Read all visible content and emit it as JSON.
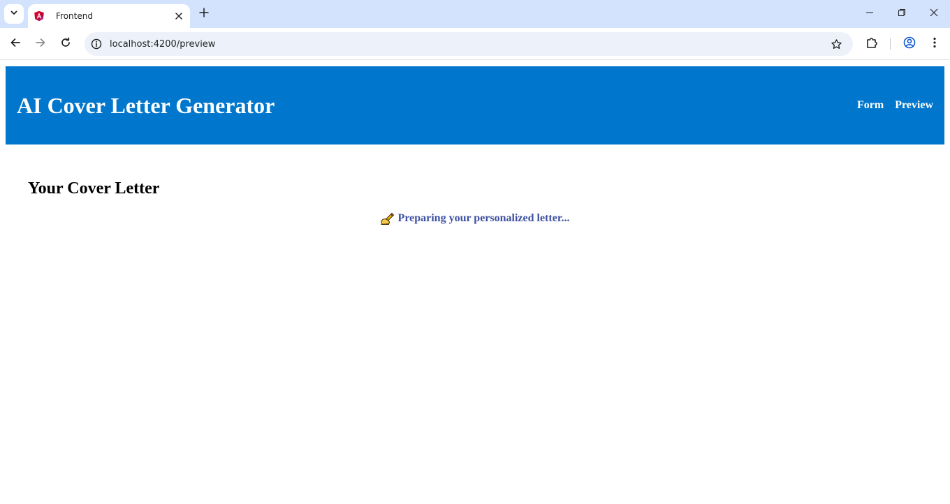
{
  "browser": {
    "tab": {
      "title": "Frontend"
    },
    "address": {
      "url": "localhost:4200/preview"
    }
  },
  "app": {
    "header": {
      "title": "AI Cover Letter Generator",
      "nav": [
        {
          "label": "Form"
        },
        {
          "label": "Preview"
        }
      ]
    },
    "main": {
      "heading": "Your Cover Letter",
      "status_text": "Preparing your personalized letter...",
      "status_icon": "writing-hand-icon"
    }
  },
  "colors": {
    "header_bg": "#0077cc",
    "status_text": "#3d50a0",
    "tabstrip_bg": "#d3e3fd",
    "omnibox_bg": "#edf2fa"
  }
}
